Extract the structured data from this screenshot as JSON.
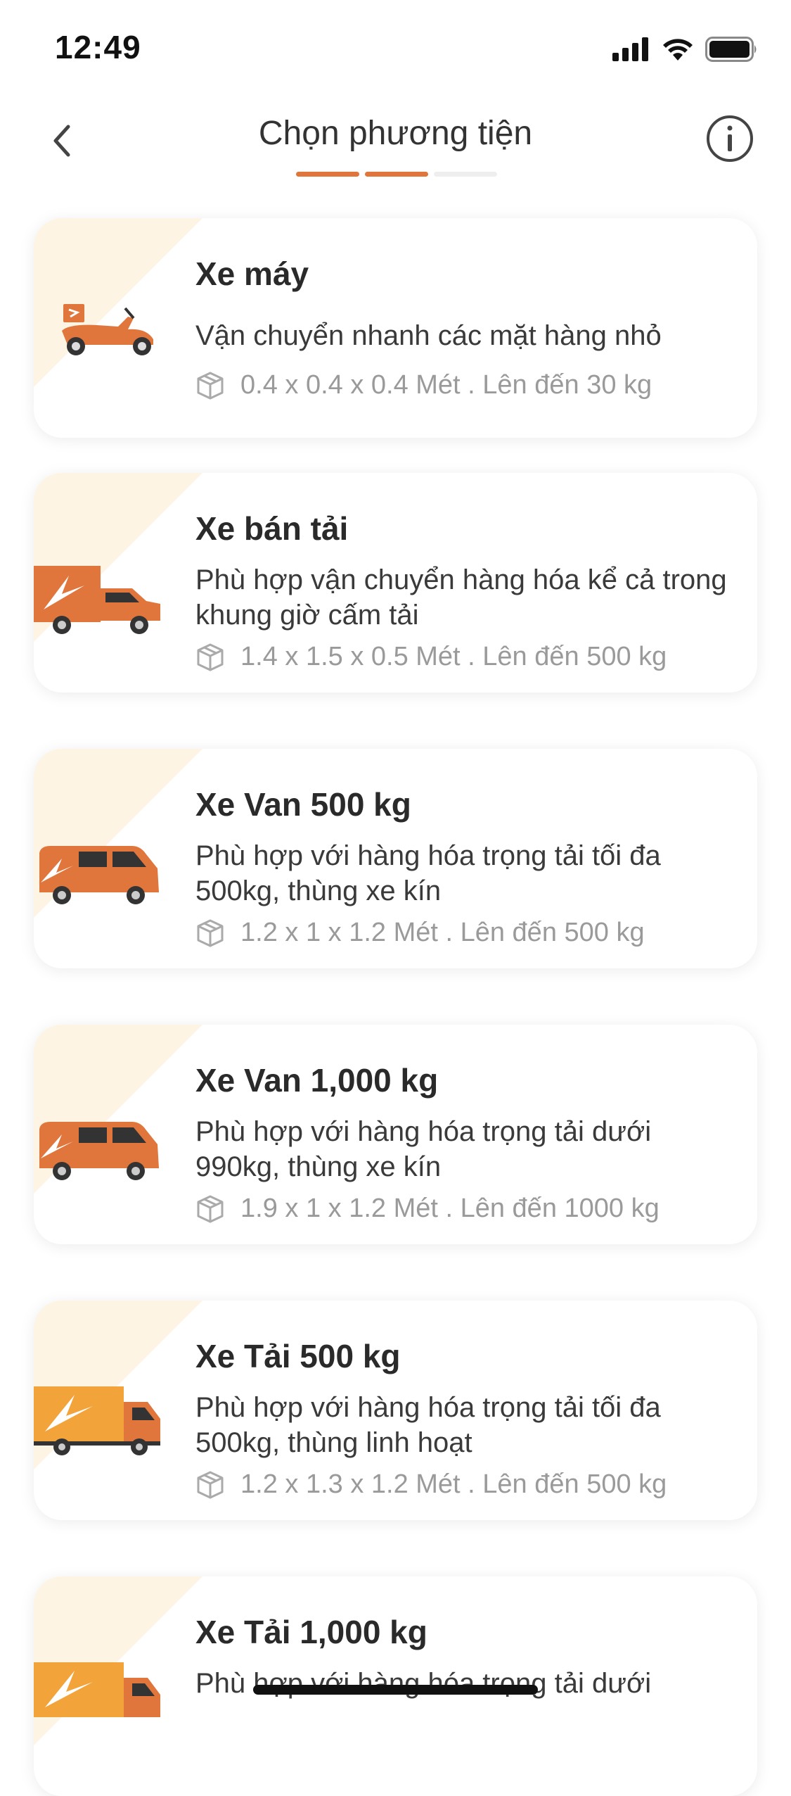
{
  "status_bar": {
    "time": "12:49",
    "signal_icon": "cellular-signal-icon",
    "wifi_icon": "wifi-icon",
    "battery_icon": "battery-icon"
  },
  "header": {
    "title": "Chọn phương tiện",
    "back_icon": "chevron-left-icon",
    "info_icon": "info-icon"
  },
  "stepper": {
    "total_steps": 3,
    "completed_steps": 2,
    "accent_color": "#e0763c"
  },
  "vehicles": [
    {
      "name": "Xe máy",
      "description": "Vận chuyển nhanh các mặt hàng nhỏ",
      "spec": "0.4 x 0.4 x 0.4 Mét . Lên đến 30 kg",
      "icon": "motorbike-icon"
    },
    {
      "name": "Xe bán tải",
      "description": "Phù hợp vận chuyển hàng hóa kể cả trong khung giờ cấm tải",
      "spec": "1.4 x 1.5 x 0.5 Mét . Lên đến 500 kg",
      "icon": "pickup-truck-icon"
    },
    {
      "name": "Xe Van 500 kg",
      "description": "Phù hợp với hàng hóa trọng tải tối đa 500kg, thùng xe kín",
      "spec": "1.2 x 1 x 1.2 Mét . Lên đến 500 kg",
      "icon": "van-icon"
    },
    {
      "name": "Xe Van 1,000 kg",
      "description": "Phù hợp với hàng hóa trọng tải dưới 990kg, thùng xe kín",
      "spec": "1.9 x 1 x 1.2 Mét . Lên đến 1000 kg",
      "icon": "van-icon"
    },
    {
      "name": "Xe Tải 500 kg",
      "description": "Phù hợp với hàng hóa trọng tải tối đa 500kg, thùng linh hoạt",
      "spec": "1.2 x 1.3 x 1.2 Mét . Lên đến 500 kg",
      "icon": "truck-icon"
    },
    {
      "name": "Xe Tải 1,000 kg",
      "description": "Phù hợp với hàng hóa trọng tải dưới",
      "spec": "",
      "icon": "truck-icon"
    }
  ],
  "colors": {
    "accent": "#e0763c",
    "card_decoration": "#fdf4e4",
    "spec_text": "#9a9a9a"
  }
}
